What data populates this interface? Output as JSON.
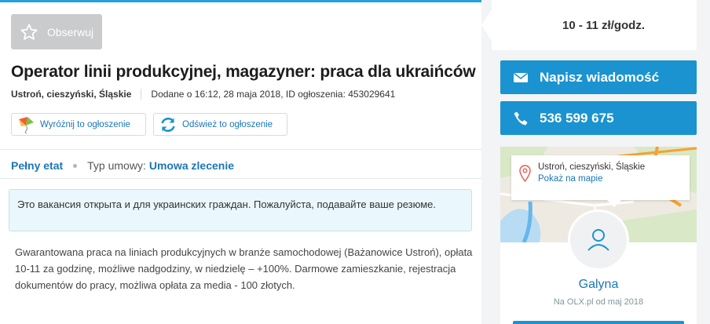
{
  "header": {
    "observe_label": "Obserwuj",
    "title": "Operator linii produkcyjnej, magazyner: praca dla ukraińców",
    "location": "Ustroń, cieszyński, Śląskie",
    "added": "Dodane o 16:12, 28 maja 2018, ID ogłoszenia: 453029641"
  },
  "promo": {
    "highlight_label": "Wyróżnij to ogłoszenie",
    "refresh_label": "Odśwież to ogłoszenie"
  },
  "tags": {
    "work_time": "Pełny etat",
    "contract_label": "Typ umowy:",
    "contract_value": "Umowa zlecenie"
  },
  "notice": "Это вакансия открыта и для украинских граждан. Пожалуйста, подавайте ваше резюме.",
  "description": "Gwarantowana praca na liniach produkcyjnych w branże samochodowej (Bażanowice Ustroń), opłata 10-11 za godzinę, możliwe nadgodziny, w niedzielę – +100%. Darmowe zamieszkanie, rejestracja dokumentów do pracy, możliwa opłata za media - 100 złotych.",
  "sidebar": {
    "salary": "10 - 11 zł/godz.",
    "message_label": "Napisz wiadomość",
    "phone": "536 599 675",
    "map_city": "Ustroń, cieszyński, Śląskie",
    "show_map": "Pokaż na mapie",
    "user_name": "Galyna",
    "member_since": "Na OLX.pl od maj 2018"
  },
  "colors": {
    "accent": "#1a93d0",
    "link": "#1a77b5",
    "top_border": "#23a1dc"
  },
  "icons": [
    "star-icon",
    "kite-icon",
    "refresh-icon",
    "envelope-icon",
    "phone-icon",
    "map-pin-icon",
    "user-icon"
  ]
}
